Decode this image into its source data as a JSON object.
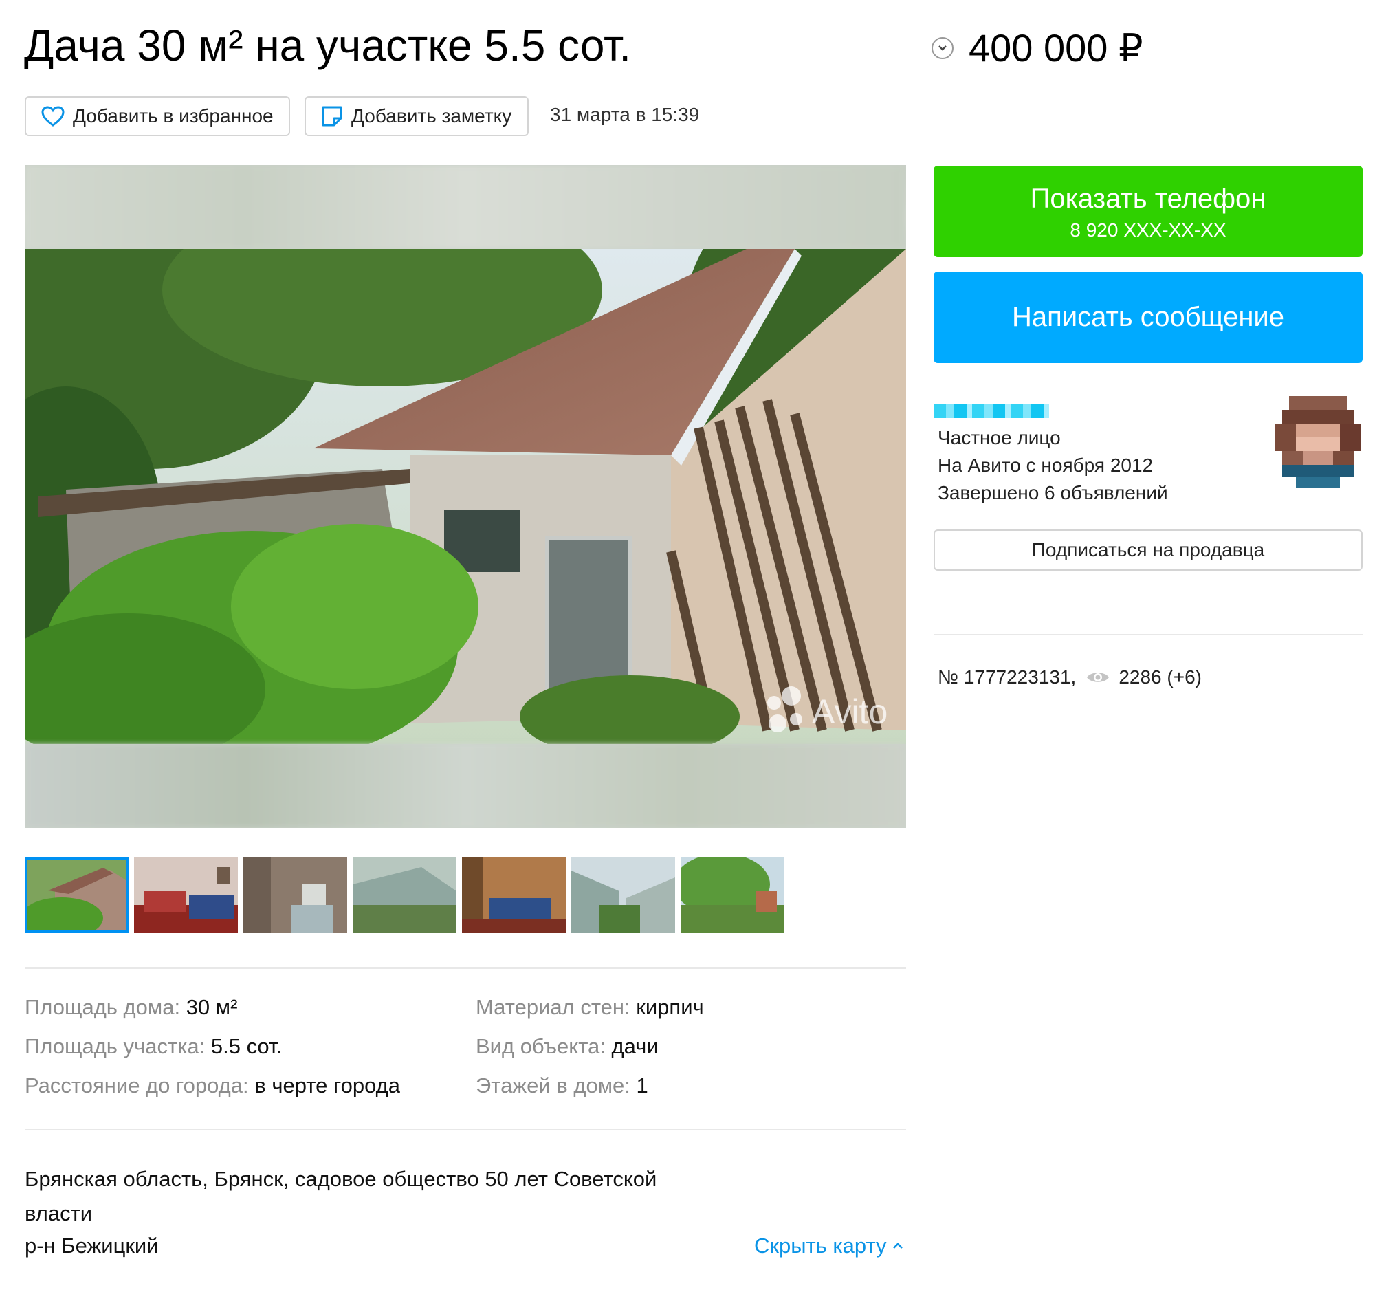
{
  "header": {
    "title": "Дача 30 м² на участке 5.5 сот.",
    "price": "400 000 ₽"
  },
  "actions": {
    "favorite_label": "Добавить в избранное",
    "note_label": "Добавить заметку",
    "date": "31 марта в 15:39"
  },
  "gallery": {
    "watermark": "Avito",
    "thumbnail_count": 7,
    "active_index": 0
  },
  "params": {
    "left": [
      {
        "key": "Площадь дома:",
        "value": "30 м²"
      },
      {
        "key": "Площадь участка:",
        "value": "5.5 сот."
      },
      {
        "key": "Расстояние до города:",
        "value": "в черте города"
      }
    ],
    "right": [
      {
        "key": "Материал стен:",
        "value": "кирпич"
      },
      {
        "key": "Вид объекта:",
        "value": "дачи"
      },
      {
        "key": "Этажей в доме:",
        "value": "1"
      }
    ]
  },
  "location": {
    "address": "Брянская область, Брянск, садовое общество 50 лет Советской власти",
    "district": "р-н Бежицкий",
    "hide_map": "Скрыть карту"
  },
  "contact": {
    "show_phone": "Показать телефон",
    "phone_masked": "8 920 XXX-XX-XX",
    "write_message": "Написать сообщение"
  },
  "seller": {
    "type": "Частное лицо",
    "since": "На Авито с ноября 2012",
    "completed": "Завершено 6 объявлений",
    "subscribe": "Подписаться на продавца"
  },
  "stats": {
    "listing_id": "№ 1777223131,",
    "views": "2286 (+6)"
  },
  "colors": {
    "green": "#2fd100",
    "blue": "#00aaff",
    "link": "#0a93e6",
    "thumb_active": "#0091f2"
  }
}
